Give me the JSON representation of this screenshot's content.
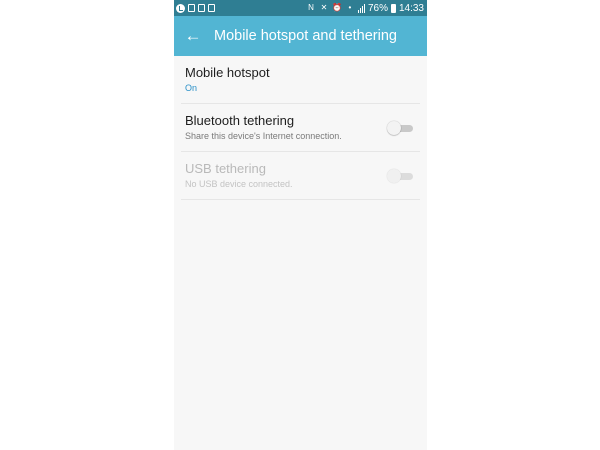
{
  "status_bar": {
    "battery_percent": "76%",
    "time": "14:33",
    "left_icons": [
      "messenger-icon",
      "gallery-icon",
      "screenshot-icon",
      "clipboard-icon"
    ],
    "right_icons": [
      "nfc-icon",
      "mute-icon",
      "alarm-icon",
      "hotspot-icon",
      "signal-icon",
      "battery-icon"
    ]
  },
  "app_bar": {
    "title": "Mobile hotspot and tethering",
    "back_icon": "back-arrow-icon"
  },
  "settings": [
    {
      "title": "Mobile hotspot",
      "subtitle": "On",
      "enabled": true,
      "has_switch": false
    },
    {
      "title": "Bluetooth tethering",
      "subtitle": "Share this device's Internet connection.",
      "enabled": true,
      "has_switch": true,
      "switch_on": false
    },
    {
      "title": "USB tethering",
      "subtitle": "No USB device connected.",
      "enabled": false,
      "has_switch": true,
      "switch_on": false
    }
  ],
  "colors": {
    "status_bar": "#2f7e93",
    "app_bar": "#52b5d3",
    "background": "#f7f7f7",
    "accent_text": "#2a90c8"
  }
}
